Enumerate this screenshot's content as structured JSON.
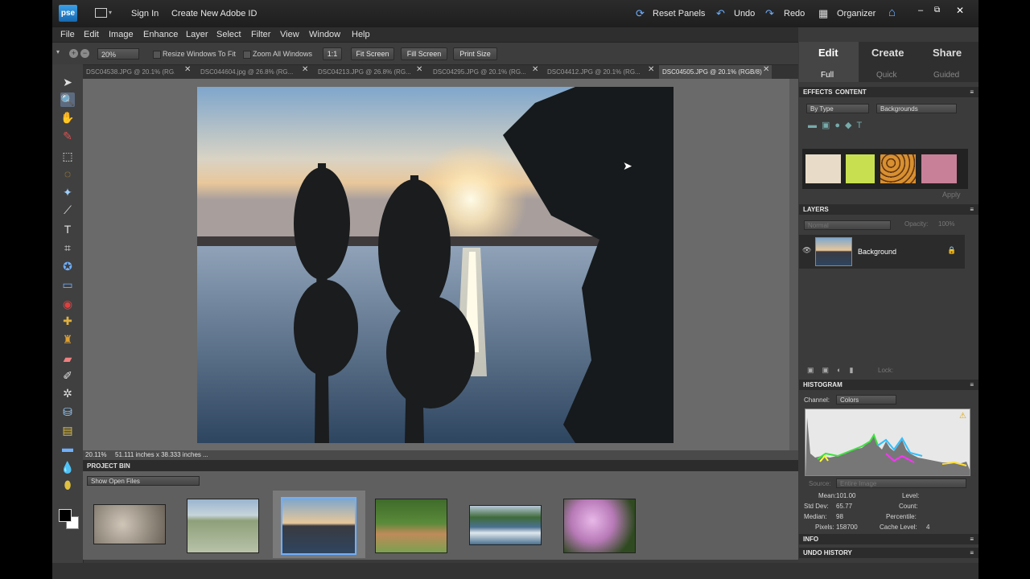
{
  "titlebar": {
    "logo": "pse",
    "sign_in": "Sign In",
    "create_id": "Create New Adobe ID",
    "reset_panels": "Reset Panels",
    "undo": "Undo",
    "redo": "Redo",
    "organizer": "Organizer"
  },
  "menu": [
    "File",
    "Edit",
    "Image",
    "Enhance",
    "Layer",
    "Select",
    "Filter",
    "View",
    "Window",
    "Help"
  ],
  "options": {
    "zoom": "20%",
    "resize_windows": "Resize Windows To Fit",
    "zoom_all": "Zoom All Windows",
    "one_to_one": "1:1",
    "fit_screen": "Fit Screen",
    "fill_screen": "Fill Screen",
    "print_size": "Print Size"
  },
  "tabs": [
    {
      "label": "DSC04538.JPG @ 20.1% (RG..."
    },
    {
      "label": "DSC044604.jpg @ 26.8% (RG..."
    },
    {
      "label": "DSC04213.JPG @ 26.8% (RG..."
    },
    {
      "label": "DSC04295.JPG @ 20.1% (RG..."
    },
    {
      "label": "DSC04412.JPG @ 20.1% (RG..."
    },
    {
      "label": "DSC04505.JPG @ 20.1% (RGB/8)"
    }
  ],
  "status": {
    "zoom": "20.11%",
    "size": "51.111 inches x 38.333 inches ..."
  },
  "project_bin": {
    "title": "PROJECT BIN",
    "show": "Show Open Files"
  },
  "modes": {
    "edit": "Edit",
    "create": "Create",
    "share": "Share",
    "full": "Full",
    "quick": "Quick",
    "guided": "Guided"
  },
  "effects": {
    "effects_tab": "EFFECTS",
    "content_tab": "CONTENT",
    "by_type": "By Type",
    "backgrounds": "Backgrounds",
    "apply": "Apply"
  },
  "layers": {
    "title": "LAYERS",
    "blend": "Normal",
    "opacity_label": "Opacity:",
    "opacity": "100%",
    "layer_name": "Background",
    "lock": "Lock:"
  },
  "histogram": {
    "title": "HISTOGRAM",
    "channel_label": "Channel:",
    "channel": "Colors",
    "source_label": "Source:",
    "source": "Entire Image",
    "stats_left": [
      {
        "label": "Mean:",
        "value": "101.00"
      },
      {
        "label": "Std Dev:",
        "value": "65.77"
      },
      {
        "label": "Median:",
        "value": "98"
      },
      {
        "label": "Pixels:",
        "value": "158700"
      }
    ],
    "stats_right": [
      {
        "label": "Level:",
        "value": ""
      },
      {
        "label": "Count:",
        "value": ""
      },
      {
        "label": "Percentile:",
        "value": ""
      },
      {
        "label": "Cache Level:",
        "value": "4"
      }
    ]
  },
  "info_title": "INFO",
  "undo_history_title": "UNDO HISTORY",
  "colors": {
    "accent": "#6fb0ff",
    "panel": "#3b3b3b",
    "canvas": "#6a6a6a"
  }
}
